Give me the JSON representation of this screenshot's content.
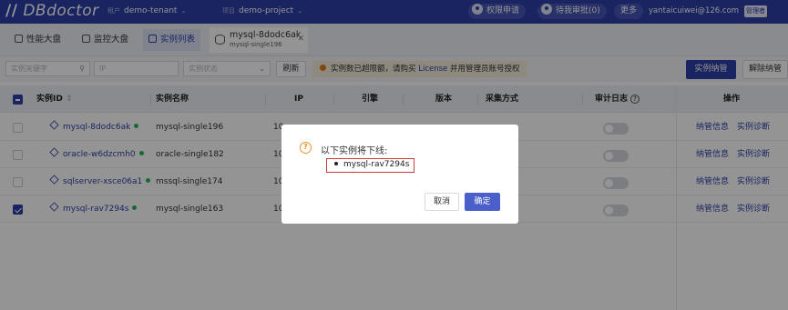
{
  "header": {
    "logo": "DBdoctor",
    "tenant_label": "租户",
    "tenant_value": "demo-tenant",
    "project_label": "项目",
    "project_value": "demo-project",
    "perm_button": "权限申请",
    "approve_button": "待我审批(0)",
    "more_button": "更多",
    "user_email": "yantaicuiwei@126.com",
    "user_role": "管理者"
  },
  "tabs": [
    {
      "label": "性能大盘",
      "icon": "dashboard-icon"
    },
    {
      "label": "监控大盘",
      "icon": "monitor-icon"
    },
    {
      "label": "实例列表",
      "icon": "list-icon"
    },
    {
      "label": "mysql-8dodc6ak",
      "sublabel": "mysql-single196",
      "icon": "database-icon"
    }
  ],
  "filters": {
    "keyword_placeholder": "实例关键字",
    "ip_placeholder": "IP",
    "status_placeholder": "实例状态",
    "refresh": "刷新",
    "warning_prefix": "实例数已超限额，请购买",
    "warning_link": "License",
    "warning_suffix": "并用管理员账号授权",
    "manage_button": "实例纳管",
    "unmanage_button": "解除纳管"
  },
  "table": {
    "headers": {
      "id": "实例ID",
      "name": "实例名称",
      "ip": "IP",
      "engine": "引擎",
      "version": "版本",
      "collect": "采集方式",
      "audit": "审计日志",
      "ops": "操作"
    },
    "rows": [
      {
        "id": "mysql-8dodc6ak",
        "name": "mysql-single196",
        "ip": "10",
        "checked": false,
        "op1": "纳管信息",
        "op2": "实例诊断"
      },
      {
        "id": "oracle-w6dzcmh0",
        "name": "oracle-single182",
        "ip": "10",
        "checked": false,
        "op1": "纳管信息",
        "op2": "实例诊断"
      },
      {
        "id": "sqlserver-xsce06a1",
        "name": "mssql-single174",
        "ip": "10",
        "checked": false,
        "op1": "纳管信息",
        "op2": "实例诊断"
      },
      {
        "id": "mysql-rav7294s",
        "name": "mysql-single163",
        "ip": "10",
        "checked": true,
        "op1": "纳管信息",
        "op2": "实例诊断"
      }
    ]
  },
  "modal": {
    "title": "以下实例将下线:",
    "items": [
      "mysql-rav7294s"
    ],
    "cancel": "取消",
    "confirm": "确定"
  },
  "colors": {
    "brand": "#2d3fa8",
    "status_ok": "#2bb35a",
    "warning": "#e07a1a",
    "highlight_border": "#d23a3a"
  }
}
